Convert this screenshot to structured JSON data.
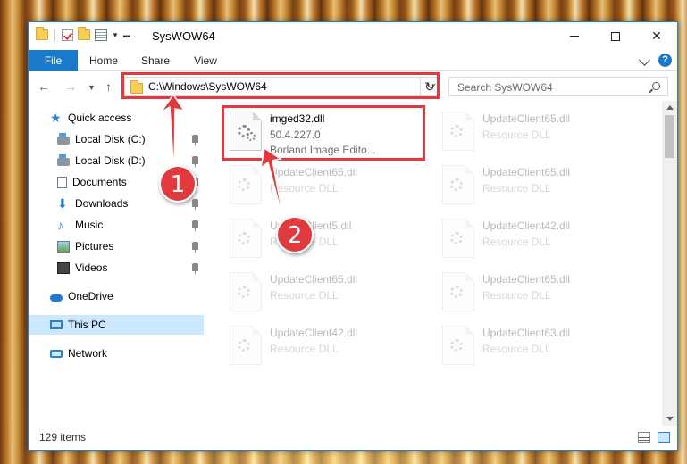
{
  "window": {
    "title": "SysWOW64"
  },
  "ribbon": {
    "tabs": [
      "File",
      "Home",
      "Share",
      "View"
    ],
    "help": "?"
  },
  "nav": {
    "address": "C:\\Windows\\SysWOW64",
    "search_placeholder": "Search SysWOW64"
  },
  "sidebar": {
    "items": [
      {
        "label": "Quick access",
        "icon": "star-icon",
        "pinned": false
      },
      {
        "label": "Local Disk (C:)",
        "icon": "disk-icon",
        "pinned": true
      },
      {
        "label": "Local Disk (D:)",
        "icon": "disk-icon",
        "pinned": true
      },
      {
        "label": "Documents",
        "icon": "documents-icon",
        "pinned": true
      },
      {
        "label": "Downloads",
        "icon": "downloads-icon",
        "pinned": true
      },
      {
        "label": "Music",
        "icon": "music-icon",
        "pinned": true
      },
      {
        "label": "Pictures",
        "icon": "pictures-icon",
        "pinned": true
      },
      {
        "label": "Videos",
        "icon": "videos-icon",
        "pinned": true
      },
      {
        "label": "OneDrive",
        "icon": "cloud-icon",
        "pinned": false
      },
      {
        "label": "This PC",
        "icon": "pc-icon",
        "pinned": false,
        "selected": true
      },
      {
        "label": "Network",
        "icon": "network-icon",
        "pinned": false
      }
    ]
  },
  "files": [
    {
      "name": "imged32.dll",
      "line2": "50.4.227.0",
      "line3": "Borland Image Edito...",
      "highlighted": true
    },
    {
      "name": "UpdateClient65.dll",
      "line2": "Resource DLL"
    },
    {
      "name": "UpdateClient65.dll",
      "line2": "Resource DLL"
    },
    {
      "name": "UpdateClient65.dll",
      "line2": "Resource DLL"
    },
    {
      "name": "UpdateClient5.dll",
      "line2": "Resource DLL"
    },
    {
      "name": "UpdateClient42.dll",
      "line2": "Resource DLL"
    },
    {
      "name": "UpdateClient65.dll",
      "line2": "Resource DLL"
    },
    {
      "name": "UpdateClient65.dll",
      "line2": "Resource DLL"
    },
    {
      "name": "UpdateClient42.dll",
      "line2": "Resource DLL"
    },
    {
      "name": "UpdateClient63.dll",
      "line2": "Resource DLL"
    }
  ],
  "status": {
    "item_count": "129 items"
  },
  "annotations": {
    "step1": "1",
    "step2": "2",
    "color": "#e0393e"
  }
}
